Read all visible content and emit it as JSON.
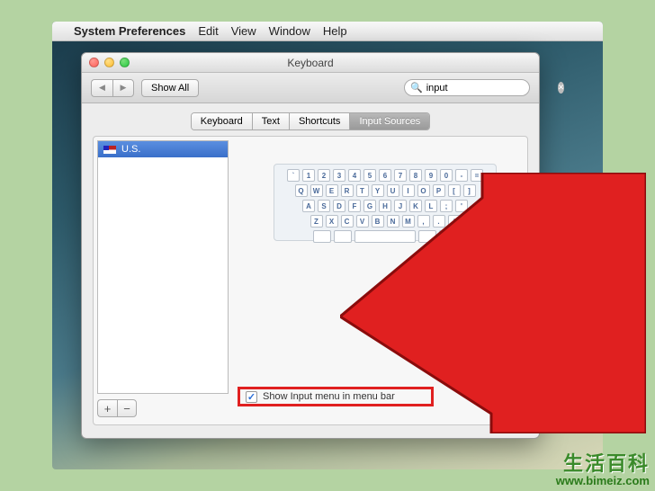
{
  "menubar": {
    "app": "System Preferences",
    "items": [
      "Edit",
      "View",
      "Window",
      "Help"
    ]
  },
  "window": {
    "title": "Keyboard",
    "showall": "Show All",
    "search_value": "input"
  },
  "tabs": {
    "items": [
      "Keyboard",
      "Text",
      "Shortcuts",
      "Input Sources"
    ],
    "active": "Input Sources"
  },
  "sources": {
    "items": [
      "U.S."
    ]
  },
  "buttons": {
    "add": "+",
    "remove": "−",
    "help": "?"
  },
  "keyboard_rows": [
    [
      "`",
      "1",
      "2",
      "3",
      "4",
      "5",
      "6",
      "7",
      "8",
      "9",
      "0",
      "-",
      "="
    ],
    [
      "Q",
      "W",
      "E",
      "R",
      "T",
      "Y",
      "U",
      "I",
      "O",
      "P",
      "[",
      "]"
    ],
    [
      "A",
      "S",
      "D",
      "F",
      "G",
      "H",
      "J",
      "K",
      "L",
      ";",
      "'"
    ],
    [
      "Z",
      "X",
      "C",
      "V",
      "B",
      "N",
      "M",
      ",",
      ".",
      "/"
    ]
  ],
  "checkbox": {
    "label": "Show Input menu in menu bar",
    "checked": true
  },
  "watermark": {
    "zh": "生活百科",
    "url": "www.bimeiz.com"
  }
}
